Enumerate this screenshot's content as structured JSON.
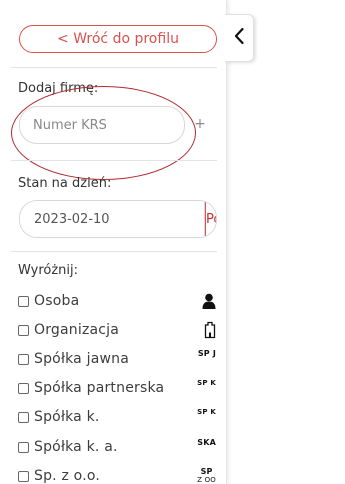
{
  "sidebar": {
    "back_label": "< Wróć do profilu",
    "add_company": {
      "label": "Dodaj firmę:",
      "input_placeholder": "Numer KRS",
      "add_symbol": "+"
    },
    "state_date": {
      "label": "Stan na dzień:",
      "date_value": "2023-02-10",
      "show_label": "Pokaż"
    },
    "highlight": {
      "label": "Wyróżnij:",
      "items": [
        {
          "label": "Osoba",
          "icon": "person-icon",
          "abbr": ""
        },
        {
          "label": "Organizacja",
          "icon": "building-icon",
          "abbr": ""
        },
        {
          "label": "Spółka jawna",
          "icon": "sp-j-icon",
          "abbr": "SP J"
        },
        {
          "label": "Spółka partnerska",
          "icon": "sp-k-icon",
          "abbr": "SP K"
        },
        {
          "label": "Spółka k.",
          "icon": "sp-k-icon",
          "abbr": "SP K"
        },
        {
          "label": "Spółka k. a.",
          "icon": "ska-icon",
          "abbr": "SKA"
        },
        {
          "label": "Sp. z o.o.",
          "icon": "sp-zoo-icon",
          "abbr_top": "SP",
          "abbr_bottom": "Z OO"
        }
      ]
    }
  },
  "colors": {
    "accent_red": "#d9534f",
    "annotation_red": "#b02a30",
    "text": "#3d3d3d"
  }
}
